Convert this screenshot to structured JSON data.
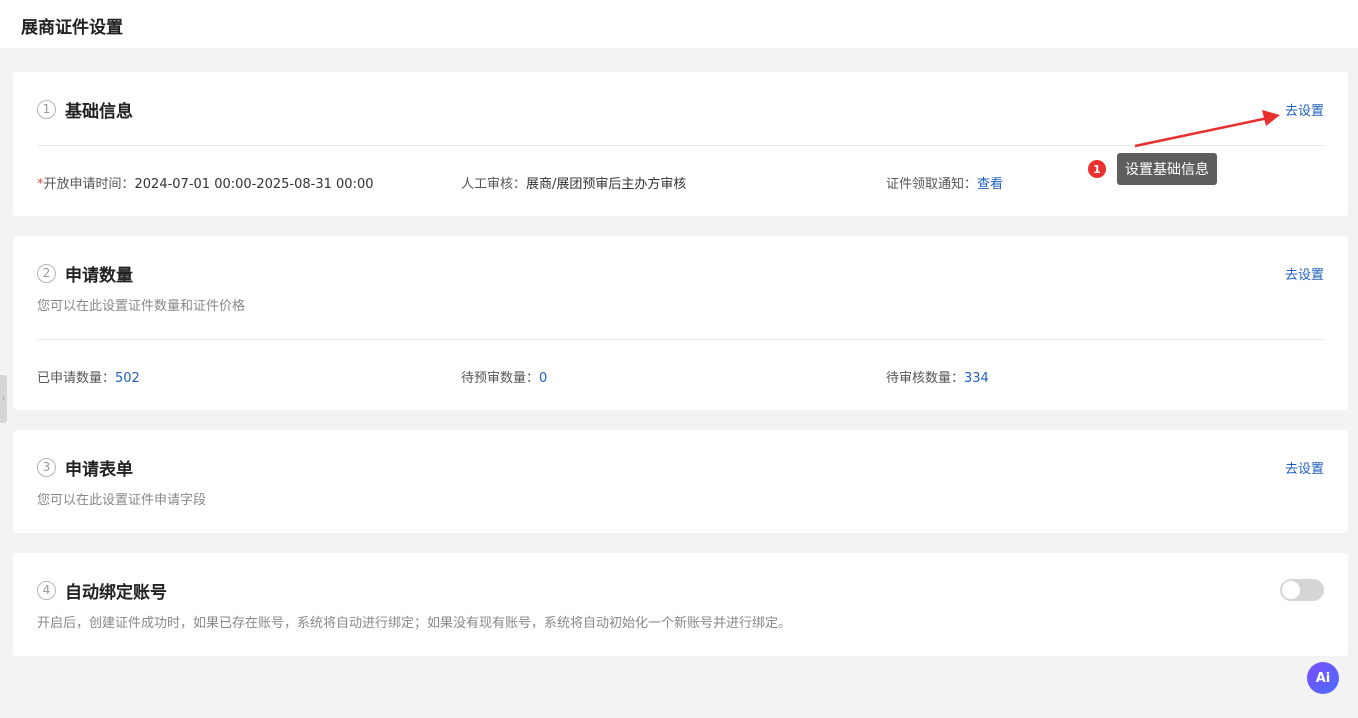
{
  "page": {
    "title": "展商证件设置"
  },
  "sections": [
    {
      "number": "1",
      "title": "基础信息",
      "action": "去设置",
      "fields": {
        "required_mark": "*",
        "apply_time_label": "开放申请时间：",
        "apply_time_value": "2024-07-01 00:00-2025-08-31 00:00",
        "review_label": "人工审核：",
        "review_value": "展商/展团预审后主办方审核",
        "notice_label": "证件领取通知：",
        "notice_link": "查看"
      }
    },
    {
      "number": "2",
      "title": "申请数量",
      "action": "去设置",
      "description": "您可以在此设置证件数量和证件价格",
      "stats": {
        "applied_label": "已申请数量：",
        "applied_value": "502",
        "pre_review_label": "待预审数量：",
        "pre_review_value": "0",
        "review_label": "待审核数量：",
        "review_value": "334"
      }
    },
    {
      "number": "3",
      "title": "申请表单",
      "action": "去设置",
      "description": "您可以在此设置证件申请字段"
    },
    {
      "number": "4",
      "title": "自动绑定账号",
      "description": "开启后，创建证件成功时，如果已存在账号，系统将自动进行绑定；如果没有现有账号，系统将自动初始化一个新账号并进行绑定。",
      "toggle_on": false
    }
  ],
  "annotation": {
    "badge": "1",
    "tooltip": "设置基础信息",
    "color": "#e8302f"
  },
  "floating": {
    "ai_label": "Ai",
    "side_handle_icon": "chevron-left-icon"
  }
}
